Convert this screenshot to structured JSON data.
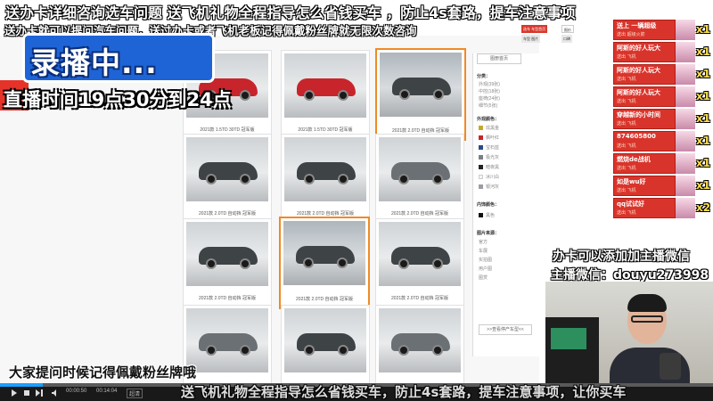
{
  "overlay": {
    "top_line1": "送办卡详细咨询选车问题  送飞机礼物全程指导怎么省钱买车 ，防止4s套路，提车注意事项",
    "top_line2": "送办卡就可以提问汽车问题，送过办卡或者飞机老板记得佩戴粉丝牌就无限次数咨询",
    "recording_label": "录播中...",
    "live_time": "直播时间19点30分到24点",
    "wechat_line1": "办卡可以添加加主播微信",
    "wechat_line2": "主播微信：douyu273998",
    "subtitle": "大家提问时候记得佩戴粉丝牌哦",
    "marquee": "送飞机礼物全程指导怎么省钱买车，防止4s套路，提车注意事项，让你买车"
  },
  "gallery": {
    "captions": [
      "2021款 1.5TD 30TD 冠军版",
      "2021款 1.5TD 30TD 冠军版",
      "2021款 2.0TD 自动挡 冠军版",
      "2021款 2.0TD 自动挡 冠军版",
      "2021款 2.0TD 自动挡 冠军版",
      "2021款 2.0TD 自动挡 冠军版",
      "2021款 2.0TD 自动挡 冠军版",
      "2021款 2.0TD 自动挡 冠军版",
      "2021款 2.0TD 自动挡 冠军版"
    ]
  },
  "filter": {
    "top_button": "图册首页",
    "section_category": "分类：",
    "categories": [
      "外观(39张)",
      "中控(18张)",
      "座椅(24张)",
      "细节(5张)"
    ],
    "section_exterior_color": "外观颜色：",
    "exterior_colors": [
      {
        "name": "炫黑金",
        "hex": "#c9a52e"
      },
      {
        "name": "枫叶红",
        "hex": "#c8242b"
      },
      {
        "name": "宝石蓝",
        "hex": "#2b4a8c"
      },
      {
        "name": "极光灰",
        "hex": "#7a7f84"
      },
      {
        "name": "暗夜黑",
        "hex": "#222222"
      },
      {
        "name": "冰川白",
        "hex": "#f4f4f4"
      },
      {
        "name": "银河灰",
        "hex": "#9a9ea2"
      }
    ],
    "section_interior_color": "内饰颜色：",
    "interior_colors": [
      {
        "name": "黑色",
        "hex": "#111111"
      }
    ],
    "section_sources": "图片来源：",
    "sources": [
      "官方",
      "车展",
      "实拍图",
      "用户图",
      "图赏"
    ],
    "more_button": ">>查看停产车型<<"
  },
  "topnav": {
    "btn1": "选车 车型首页",
    "btn2": "报价",
    "btn3": "车型 图片",
    "btn4": "口碑"
  },
  "gifts": [
    {
      "title": "送上 一辆超级",
      "sub": "送出 超级火箭",
      "count": "x1"
    },
    {
      "title": "阿斯的好人玩大",
      "sub": "送出 飞机",
      "count": "x1"
    },
    {
      "title": "阿斯的好人玩大",
      "sub": "送出 飞机",
      "count": "x1"
    },
    {
      "title": "阿斯的好人玩大",
      "sub": "送出 飞机",
      "count": "x1"
    },
    {
      "title": "穿越新的小时间",
      "sub": "送出 飞机",
      "count": "x1"
    },
    {
      "title": "874605800",
      "sub": "送出 飞机",
      "count": "x1"
    },
    {
      "title": "燃烧de战机",
      "sub": "送出 飞机",
      "count": "x1"
    },
    {
      "title": "如是wu好",
      "sub": "送出 飞机",
      "count": "x1"
    },
    {
      "title": "qq试试好",
      "sub": "送出 飞机",
      "count": "x2"
    }
  ],
  "player": {
    "current_time": "00:00:50",
    "total_time": "00:14:04",
    "quality": "超清",
    "progress": 0.06
  }
}
